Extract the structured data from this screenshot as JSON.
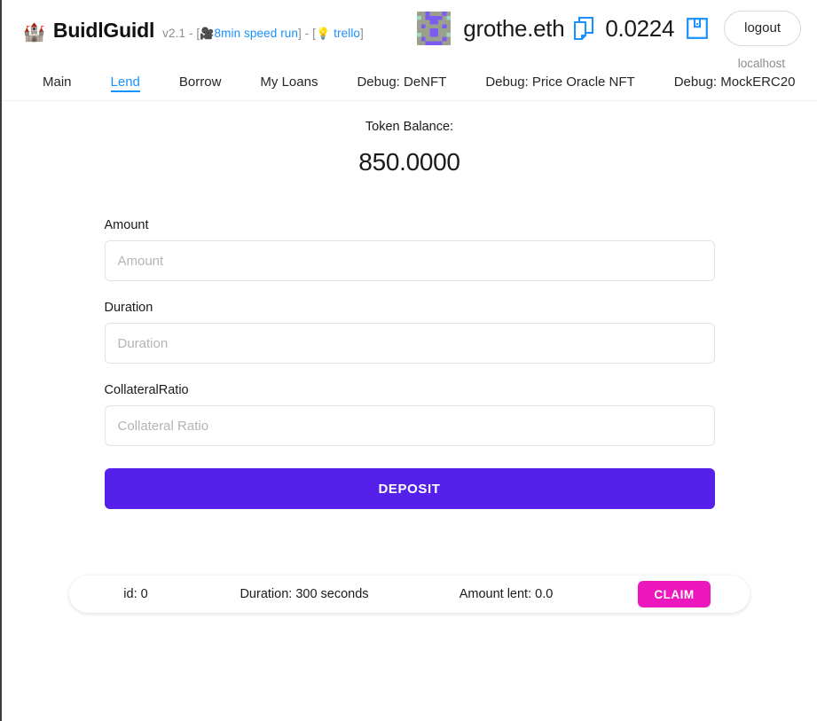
{
  "header": {
    "logo_emoji": "🏰",
    "brand_name": "BuidlGuidl",
    "version": "v2.1",
    "meta_sep_1": " - [",
    "camera_emoji": "🎥",
    "speed_run_link": "8min speed run",
    "meta_sep_2": "] - [",
    "bulb_emoji": "💡",
    "trello_link": "trello",
    "meta_sep_3": "]",
    "ens_name": "grothe.eth",
    "eth_balance": "0.0224",
    "logout_label": "logout",
    "network": "localhost",
    "copy_icon": "copy-icon",
    "qr_icon": "qr-wallet-icon",
    "avatar": "blockie-avatar"
  },
  "nav": {
    "items": [
      {
        "label": "Main",
        "active": false
      },
      {
        "label": "Lend",
        "active": true
      },
      {
        "label": "Borrow",
        "active": false
      },
      {
        "label": "My Loans",
        "active": false
      },
      {
        "label": "Debug: DeNFT",
        "active": false
      },
      {
        "label": "Debug: Price Oracle NFT",
        "active": false
      },
      {
        "label": "Debug: MockERC20",
        "active": false
      }
    ]
  },
  "main": {
    "token_balance_label": "Token Balance:",
    "token_balance_value": "850.0000",
    "fields": [
      {
        "label": "Amount",
        "placeholder": "Amount",
        "value": ""
      },
      {
        "label": "Duration",
        "placeholder": "Duration",
        "value": ""
      },
      {
        "label": "CollateralRatio",
        "placeholder": "Collateral Ratio",
        "value": ""
      }
    ],
    "deposit_label": "DEPOSIT"
  },
  "loans": [
    {
      "id": "id: 0",
      "duration": "Duration: 300 seconds",
      "amount_lent": "Amount lent: 0.0",
      "action_label": "CLAIM"
    }
  ],
  "colors": {
    "accent_blue": "#1890ff",
    "deposit_purple": "#5521ea",
    "claim_magenta": "#ec17bd",
    "muted_text": "#8c8c8c",
    "border": "#e2e2e4"
  }
}
